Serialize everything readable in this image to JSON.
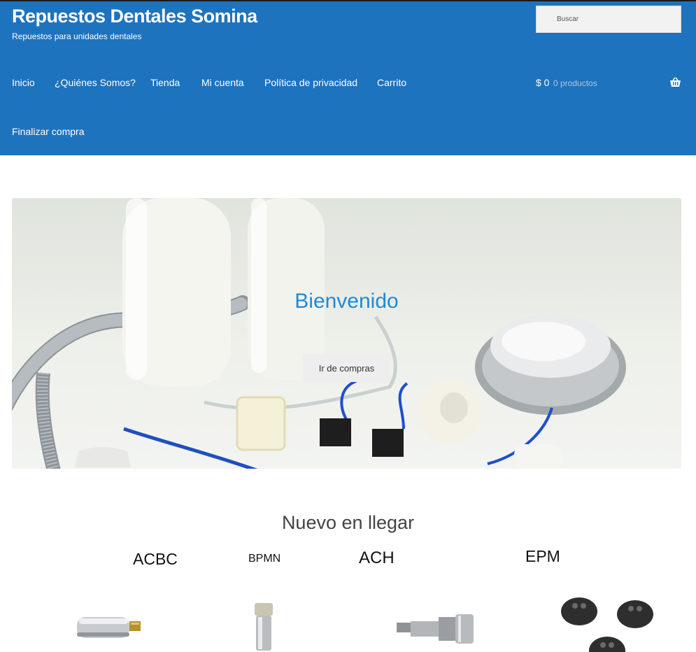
{
  "header": {
    "site_title": "Repuestos Dentales Somina",
    "tagline": "Repuestos para unidades dentales",
    "search_placeholder": "Buscar"
  },
  "nav": {
    "items": [
      {
        "label": "Inicio"
      },
      {
        "label": "¿Quiénes Somos?"
      },
      {
        "label": "Tienda"
      },
      {
        "label": "Mi cuenta"
      },
      {
        "label": "Política de privacidad"
      },
      {
        "label": "Carrito"
      },
      {
        "label": "Finalizar compra"
      }
    ],
    "cart_total": "$ 0",
    "cart_count": "0 productos"
  },
  "hero": {
    "title": "Bienvenido",
    "button_label": "Ir de compras"
  },
  "section": {
    "title": "Nuevo en llegar"
  },
  "products": [
    {
      "label": "ACBC"
    },
    {
      "label": "BPMN"
    },
    {
      "label": "ACH"
    },
    {
      "label": "EPM"
    }
  ],
  "colors": {
    "header_bg": "#1e73be",
    "hero_title": "#1f8ad6",
    "cart_count": "#a9c9ea"
  }
}
